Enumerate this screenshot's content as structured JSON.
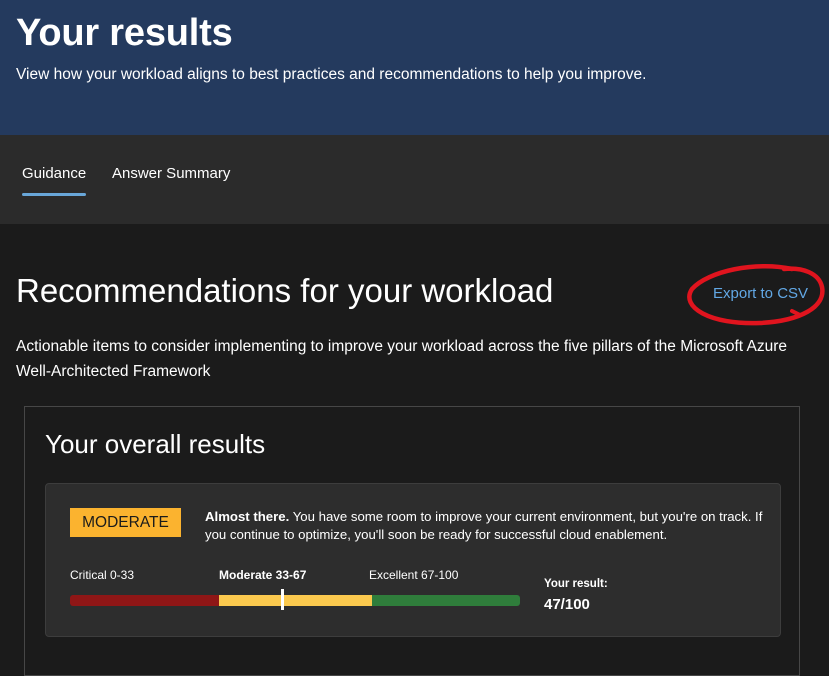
{
  "header": {
    "title": "Your results",
    "subtitle": "View how your workload aligns to best practices and recommendations to help you improve."
  },
  "tabs": [
    {
      "label": "Guidance",
      "active": true
    },
    {
      "label": "Answer Summary",
      "active": false
    }
  ],
  "recommendations": {
    "title": "Recommendations for your workload",
    "export_label": "Export to CSV",
    "description": "Actionable items to consider implementing to improve your workload across the five pillars of the Microsoft Azure Well-Architected Framework"
  },
  "overall": {
    "title": "Your overall results",
    "badge": "MODERATE",
    "message_bold": "Almost there.",
    "message": " You have some room to improve your current environment, but you're on track. If you continue to optimize, you'll soon be ready for successful cloud enablement.",
    "ranges": [
      {
        "label": "Critical 0-33",
        "min": 0,
        "max": 33,
        "color": "#8f1616"
      },
      {
        "label": "Moderate 33-67",
        "min": 33,
        "max": 67,
        "color": "#fbc94e"
      },
      {
        "label": "Excellent 67-100",
        "min": 67,
        "max": 100,
        "color": "#2f7d3b"
      }
    ],
    "score": 47,
    "score_max": 100,
    "result_label": "Your result:",
    "result_value": "47/100"
  },
  "colors": {
    "hero_bg": "#243a5e",
    "tab_underline": "#69a7d9",
    "link": "#62a8e5",
    "badge": "#fbb32f",
    "annotation": "#e0141e"
  }
}
